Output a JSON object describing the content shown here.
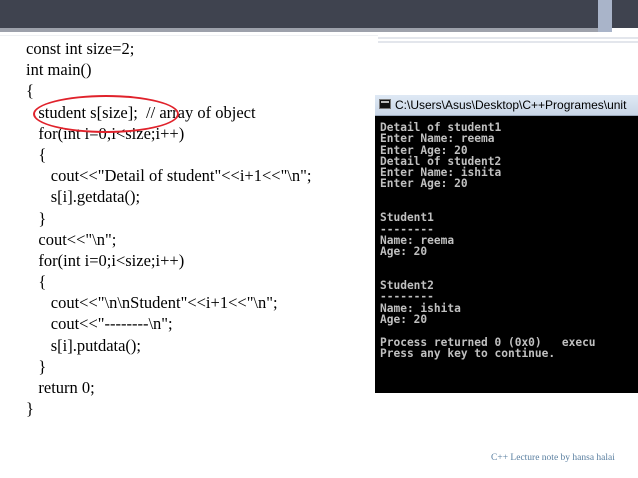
{
  "code_lines": [
    "const int size=2;",
    "int main()",
    "{",
    "   student s[size];  // array of object",
    "   for(int i=0;i<size;i++)",
    "   {",
    "      cout<<\"Detail of student\"<<i+1<<\"\\n\";",
    "      s[i].getdata();",
    "   }",
    "   cout<<\"\\n\";",
    "   for(int i=0;i<size;i++)",
    "   {",
    "      cout<<\"\\n\\nStudent\"<<i+1<<\"\\n\";",
    "      cout<<\"--------\\n\";",
    "      s[i].putdata();",
    "   }",
    "   return 0;",
    "}"
  ],
  "console": {
    "title": "C:\\Users\\Asus\\Desktop\\C++Programes\\unit",
    "lines": [
      "Detail of student1",
      "Enter Name: reema",
      "Enter Age: 20",
      "Detail of student2",
      "Enter Name: ishita",
      "Enter Age: 20",
      "",
      "",
      "Student1",
      "--------",
      "Name: reema",
      "Age: 20",
      "",
      "",
      "Student2",
      "--------",
      "Name: ishita",
      "Age: 20",
      "",
      "Process returned 0 (0x0)   execu",
      "Press any key to continue."
    ]
  },
  "footer": "C++  Lecture note by hansa halai",
  "colors": {
    "highlight": "#e0222b",
    "header_bar": "#3f434f",
    "footer_text": "#5a7fa0"
  }
}
